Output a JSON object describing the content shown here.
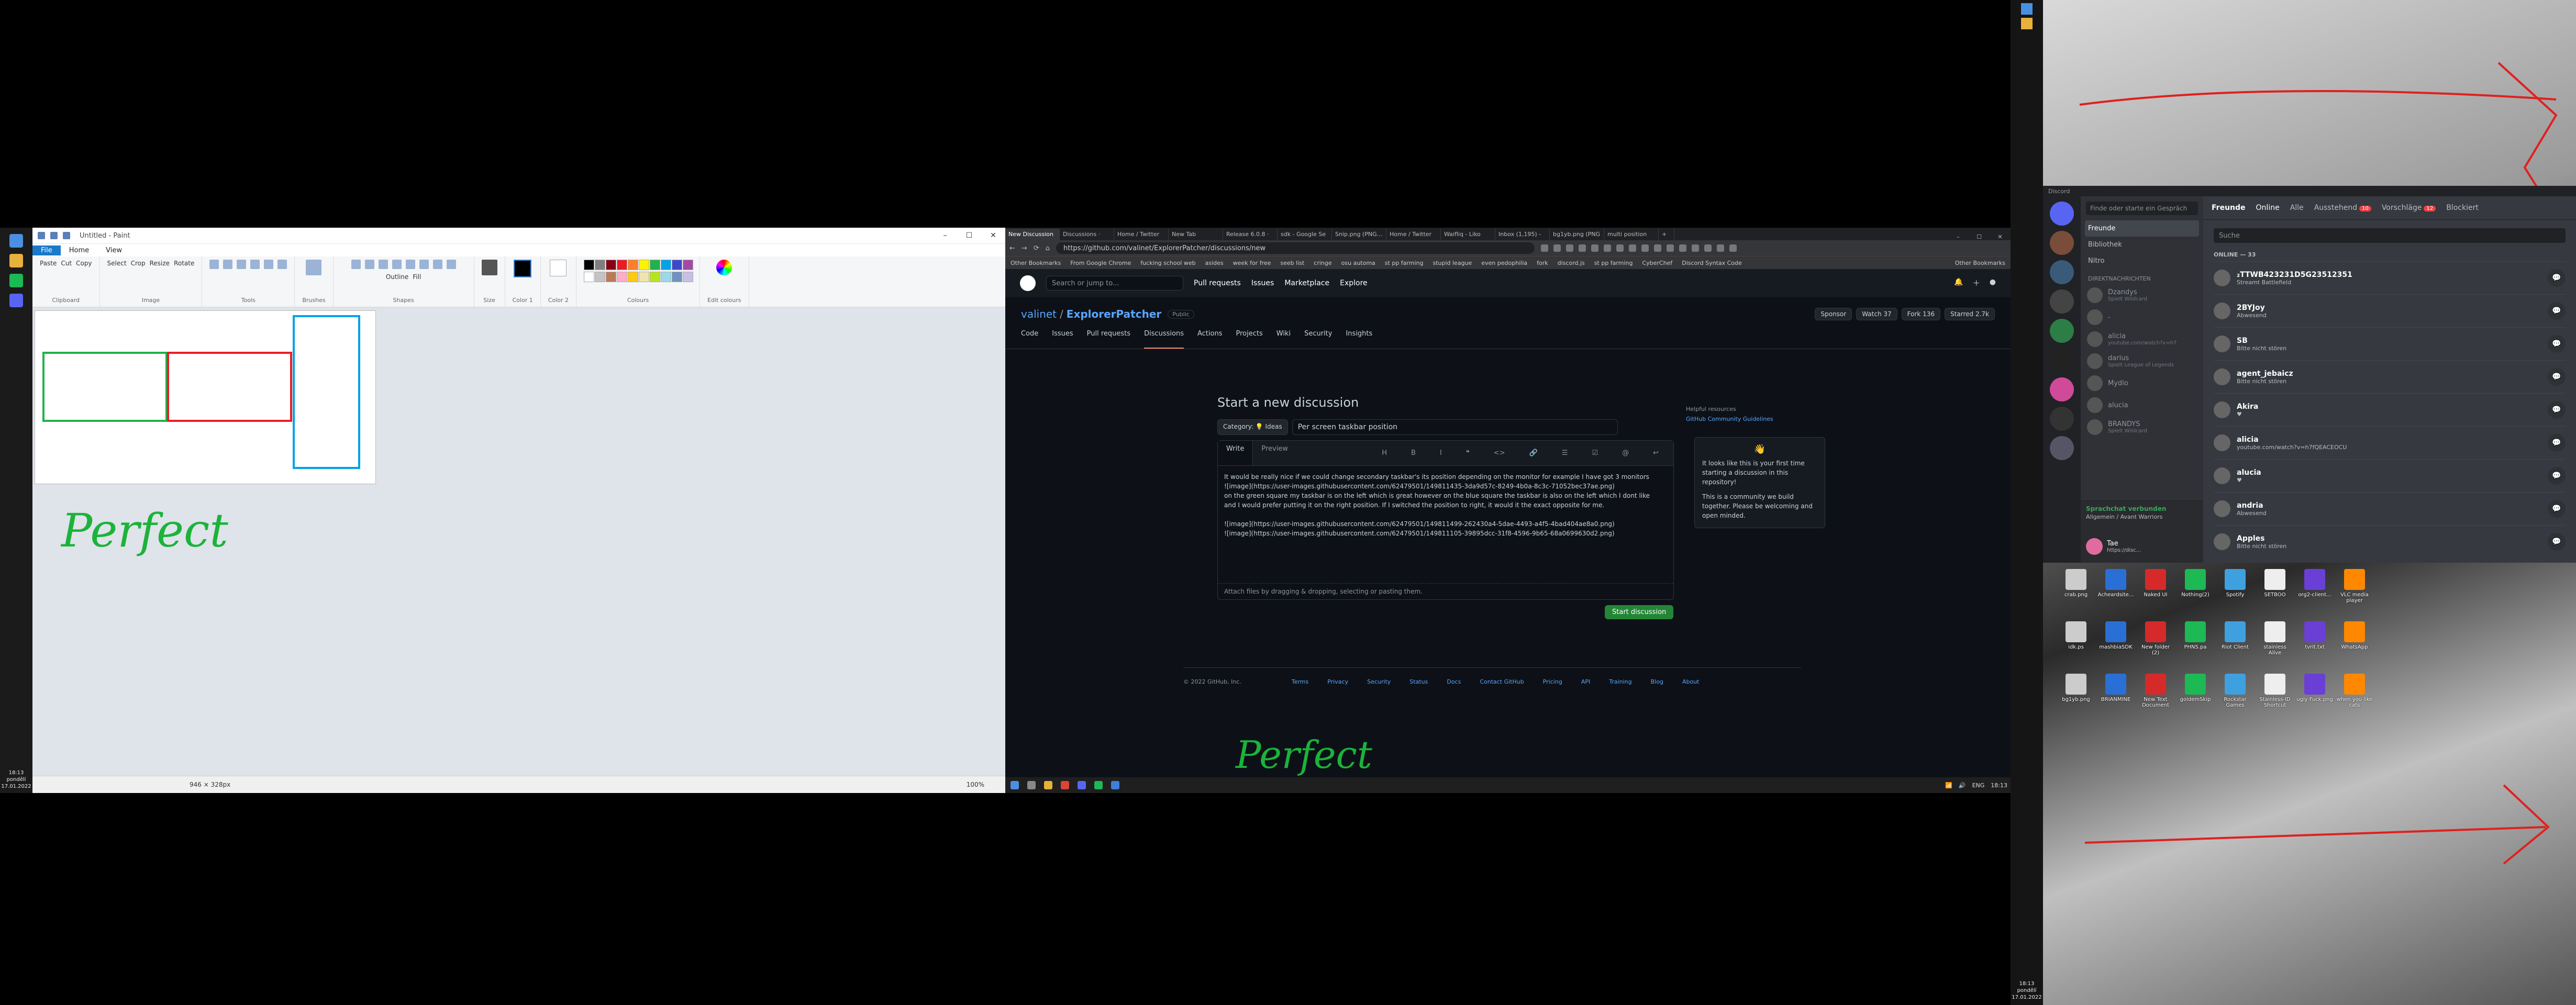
{
  "paint": {
    "title": "Untitled - Paint",
    "menu_tabs": [
      "File",
      "Home",
      "View"
    ],
    "groups": {
      "clipboard": "Clipboard",
      "image": "Image",
      "tools": "Tools",
      "brushes": "Brushes",
      "shapes": "Shapes",
      "size": "Size",
      "color1": "Color 1",
      "color2": "Color 2",
      "colours": "Colours",
      "edit_colours": "Edit colours"
    },
    "clip_items": [
      "Cut",
      "Copy",
      "Paste"
    ],
    "image_items": [
      "Crop",
      "Resize",
      "Rotate",
      "Select"
    ],
    "shape_opts": [
      "Outline",
      "Fill"
    ],
    "status_dims": "946 × 328px",
    "zoom": "100%",
    "handwriting": "Perfect",
    "palette": [
      "#000000",
      "#7f7f7f",
      "#880015",
      "#ed1c24",
      "#ff7f27",
      "#fff200",
      "#22b14c",
      "#00a2e8",
      "#3f48cc",
      "#a349a4",
      "#ffffff",
      "#c3c3c3",
      "#b97a57",
      "#ffaec9",
      "#ffc90e",
      "#efe4b0",
      "#b5e61d",
      "#99d9ea",
      "#7092be",
      "#c8bfe7"
    ],
    "shapes_drawn": {
      "green": "#22b14c",
      "red": "#ed1c24",
      "blue": "#00a2e8"
    }
  },
  "left_clock": {
    "time": "18:13",
    "day": "pondělí",
    "date": "17.01.2022"
  },
  "chrome": {
    "tabs": [
      "New Discussion",
      "Discussions ·",
      "Home / Twitter",
      "New Tab",
      "Release 6.0.8 ·",
      "sdk - Google Se",
      "Snip.png (PNG In",
      "Home / Twitter",
      "Waifliq - Liko",
      "Inbox (1,195) -",
      "bg1yb.png (PNG",
      "multi position"
    ],
    "url": "https://github.com/valinet/ExplorerPatcher/discussions/new",
    "bookmarks": [
      "Other Bookmarks",
      "From Google Chrome",
      "fucking school web",
      "asides",
      "week for free",
      "seeb list",
      "cringe",
      "osu automa",
      "st pp farming",
      "stupid league",
      "even pedophilia",
      "fork",
      "discord.js",
      "st pp farming",
      "CyberChef",
      "Discord Syntax Code"
    ],
    "other_bookmarks": "Other Bookmarks"
  },
  "github": {
    "search": "Search or jump to...",
    "nav": [
      "Pull requests",
      "Issues",
      "Marketplace",
      "Explore"
    ],
    "owner": "valinet",
    "repo": "ExplorerPatcher",
    "visibility": "Public",
    "actions": [
      "Sponsor",
      "Watch 37",
      "Fork 136",
      "Starred 2.7k"
    ],
    "tabs": [
      "Code",
      "Issues",
      "Pull requests",
      "Discussions",
      "Actions",
      "Projects",
      "Wiki",
      "Security",
      "Insights"
    ],
    "heading": "Start a new discussion",
    "category": "Category: 💡 Ideas",
    "discussion_title": "Per screen taskbar position",
    "editor_tabs": [
      "Write",
      "Preview"
    ],
    "body_lines": [
      "It would be really nice if we could change secondary taskbar's its position depending on the monitor for example I have got 3 monitors",
      "![image](https://user-images.githubusercontent.com/62479501/149811435-3da9d57c-8249-4b0a-8c3c-71052bec37ae.png)",
      "on the green square my taskbar is on the left which is great however on the blue square the taskbar is also on the left which I dont like",
      "and I would prefer putting it on the right position. If I switched the position to right, it would it the exact opposite for me.",
      "",
      "![image](https://user-images.githubusercontent.com/62479501/149811499-262430a4-5dae-4493-a4f5-4bad404ae8a0.png)",
      "![image](https://user-images.githubusercontent.com/62479501/149811105-39895dcc-31f8-4596-9b65-68a0699630d2.png)"
    ],
    "attach": "Attach files by dragging & dropping, selecting or pasting them.",
    "submit": "Start discussion",
    "helpful_title": "Helpful resources",
    "helpful_link": "GitHub Community Guidelines",
    "popover_text": "It looks like this is your first time starting a discussion in this repository!",
    "popover_text2": "This is a community we build together. Please be welcoming and open minded.",
    "footer": [
      "© 2022 GitHub, Inc.",
      "Terms",
      "Privacy",
      "Security",
      "Status",
      "Docs",
      "Contact GitHub",
      "Pricing",
      "API",
      "Training",
      "Blog",
      "About"
    ],
    "handwriting": "Perfect"
  },
  "taskbar2": {
    "lang": "ENG",
    "time": "18:13"
  },
  "right_clock": {
    "time": "18:13",
    "day": "pondělí",
    "date": "17.01.2022"
  },
  "discord": {
    "app": "Discord",
    "search": "Finde oder starte ein Gespräch",
    "nav": [
      "Freunde",
      "Bibliothek",
      "Nitro"
    ],
    "dm_header": "DIREKTNACHRICHTEN",
    "dms": [
      {
        "name": "Dzandys",
        "sub": "Spielt Wildcard"
      },
      {
        "name": "-",
        "sub": ""
      },
      {
        "name": "alicia",
        "sub": "youtube.com/watch?v=h7"
      },
      {
        "name": "darius",
        "sub": "Spielt League of Legends"
      },
      {
        "name": "Mydlo",
        "sub": ""
      },
      {
        "name": "alucia",
        "sub": ""
      },
      {
        "name": "BRANDYS",
        "sub": "Spielt Wildcard"
      }
    ],
    "voice_status": "Sprachchat verbunden",
    "voice_channel": "Allgemein / Avant Warriors",
    "voice_buttons": [
      "Video",
      "Bildschirm"
    ],
    "user": {
      "name": "Tae",
      "tag": "https://disc..."
    },
    "top_tabs": [
      "Freunde",
      "Online",
      "Alle",
      "Ausstehend",
      "Vorschläge",
      "Blockiert"
    ],
    "pending_count": "10",
    "suggest_count": "12",
    "friend_search": "Suche",
    "online_header": "ONLINE — 33",
    "friends": [
      {
        "name": "₂TTWB423231D5G23512351",
        "status": "Streamt Battlefield"
      },
      {
        "name": "2BYJoy",
        "status": "Abwesend"
      },
      {
        "name": "SB",
        "status": "Bitte nicht stören"
      },
      {
        "name": "agent_jebaicz",
        "status": "Bitte nicht stören"
      },
      {
        "name": "Akira",
        "status": "♥"
      },
      {
        "name": "alicia",
        "status": "youtube.com/watch?v=h7fQEACEOCU"
      },
      {
        "name": "alucia",
        "status": "♥"
      },
      {
        "name": "andria",
        "status": "Abwesend"
      },
      {
        "name": "Apples",
        "status": "Bitte nicht stören"
      }
    ]
  },
  "desktop_icons": [
    "crab.png",
    "Acheardsite...",
    "Naked UI",
    "Nothing(2)",
    "Spotify",
    "SETBOO",
    "org2-client...",
    "VLC media player",
    "idk.ps",
    "mashbiaSDK",
    "New folder (2)",
    "PHNS.pa",
    "Riot Client",
    "stainless Alive",
    "tvrit.txt",
    "WhatsApp",
    "bg1yb.png",
    "BRIANMINE",
    "New Text Document",
    "goldemSkip",
    "Rockstar Games",
    "Stainless-ID Shortcut",
    "ugly Fuck.png",
    "when you like cats"
  ]
}
